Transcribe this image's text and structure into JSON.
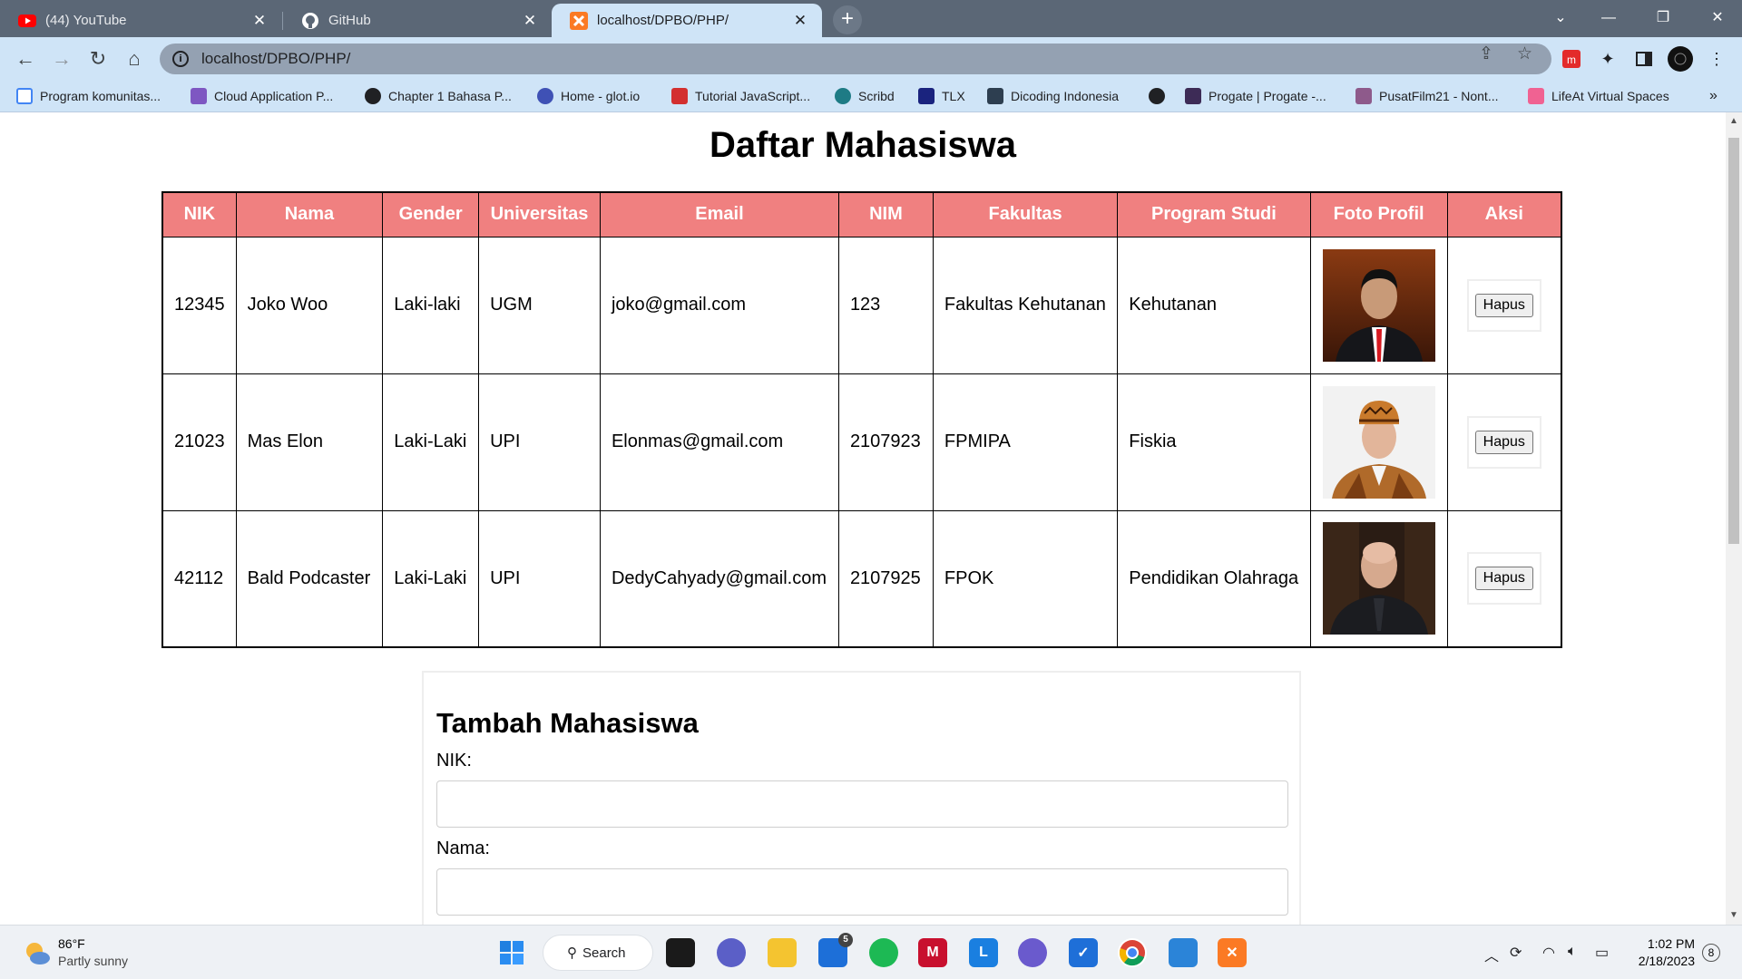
{
  "browser": {
    "tabs": [
      {
        "title": "(44) YouTube",
        "icon": "youtube-icon",
        "active": false
      },
      {
        "title": "GitHub",
        "icon": "github-icon",
        "active": false
      },
      {
        "title": "localhost/DPBO/PHP/",
        "icon": "xampp-icon",
        "active": true
      }
    ],
    "url": "localhost/DPBO/PHP/",
    "bookmarks": [
      {
        "label": "Program komunitas...",
        "color": "#e8eaed"
      },
      {
        "label": "Cloud Application P...",
        "color": "#7e57c2"
      },
      {
        "label": "Chapter 1 Bahasa P...",
        "color": "#202124"
      },
      {
        "label": "Home - glot.io",
        "color": "#3f51b5"
      },
      {
        "label": "Tutorial JavaScript...",
        "color": "#d32f2f"
      },
      {
        "label": "Scribd",
        "color": "#1e7b85"
      },
      {
        "label": "TLX",
        "color": "#1a237e"
      },
      {
        "label": "Dicoding Indonesia",
        "color": "#2d3e50"
      },
      {
        "label": "",
        "color": "#202124"
      },
      {
        "label": "Progate | Progate -...",
        "color": "#3d2b56"
      },
      {
        "label": "PusatFilm21 - Nont...",
        "color": "#8e5a8b"
      },
      {
        "label": "LifeAt Virtual Spaces",
        "color": "#f06292"
      }
    ]
  },
  "page": {
    "title": "Daftar Mahasiswa",
    "columns": [
      "NIK",
      "Nama",
      "Gender",
      "Universitas",
      "Email",
      "NIM",
      "Fakultas",
      "Program Studi",
      "Foto Profil",
      "Aksi"
    ],
    "rows": [
      {
        "nik": "12345",
        "nama": "Joko Woo",
        "gender": "Laki-laki",
        "universitas": "UGM",
        "email": "joko@gmail.com",
        "nim": "123",
        "fakultas": "Fakultas Kehutanan",
        "prodi": "Kehutanan",
        "action": "Hapus"
      },
      {
        "nik": "21023",
        "nama": "Mas Elon",
        "gender": "Laki-Laki",
        "universitas": "UPI",
        "email": "Elonmas@gmail.com",
        "nim": "2107923",
        "fakultas": "FPMIPA",
        "prodi": "Fiskia",
        "action": "Hapus"
      },
      {
        "nik": "42112",
        "nama": "Bald Podcaster",
        "gender": "Laki-Laki",
        "universitas": "UPI",
        "email": "DedyCahyady@gmail.com",
        "nim": "2107925",
        "fakultas": "FPOK",
        "prodi": "Pendidikan Olahraga",
        "action": "Hapus"
      }
    ],
    "form": {
      "title": "Tambah Mahasiswa",
      "nik_label": "NIK:",
      "nik_value": "",
      "nama_label": "Nama:",
      "nama_value": ""
    },
    "header_color": "#f08080"
  },
  "taskbar": {
    "weather_temp": "86°F",
    "weather_desc": "Partly sunny",
    "search_label": "Search",
    "mail_badge": "5",
    "time": "1:02 PM",
    "date": "2/18/2023",
    "notification_count": "8"
  }
}
